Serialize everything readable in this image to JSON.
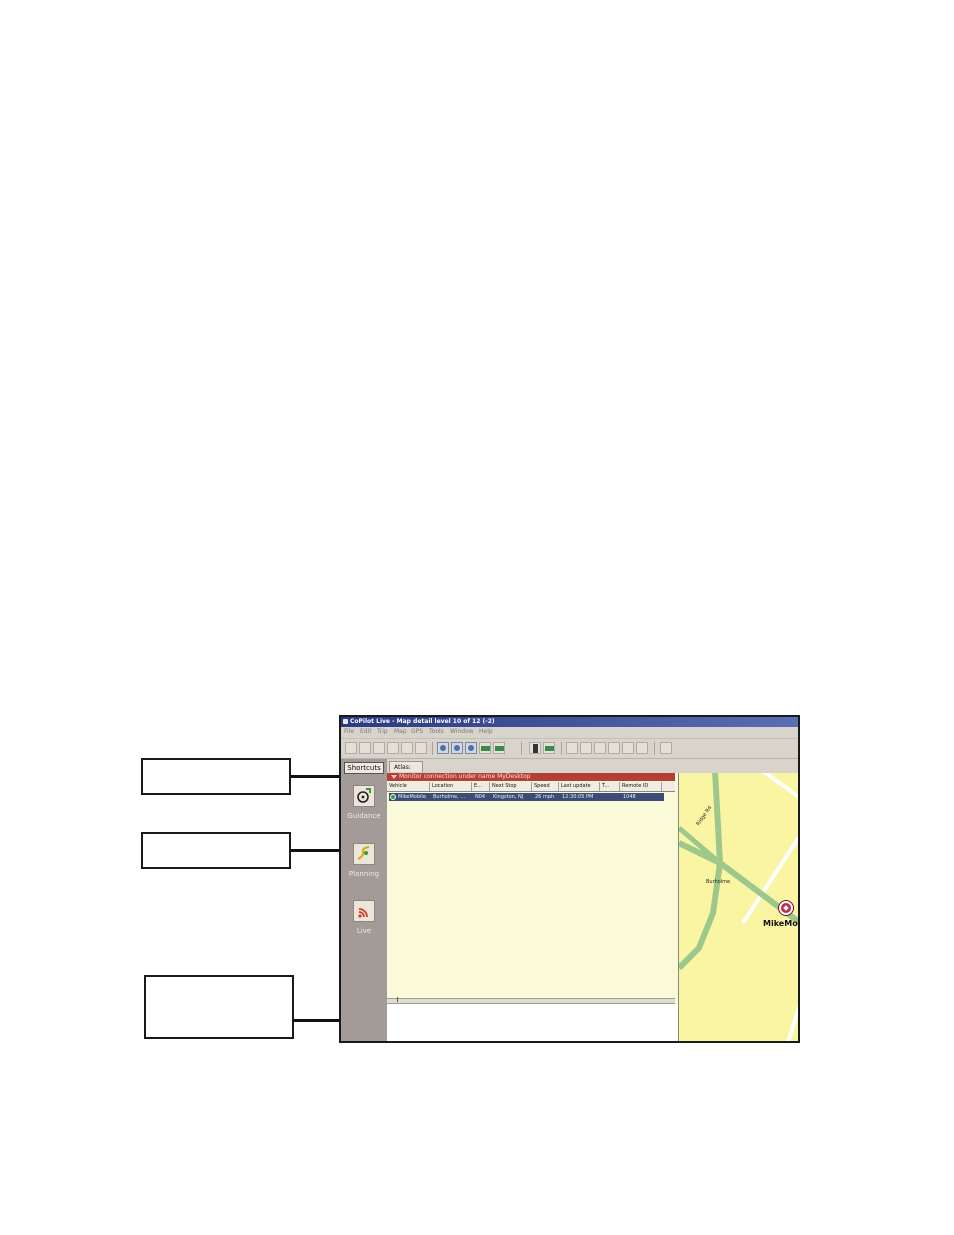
{
  "window": {
    "title": "CoPilot Live - Map detail level 10 of 12 (-2)"
  },
  "menu": [
    "File",
    "Edit",
    "Trip",
    "Map",
    "GPS",
    "Tools",
    "Window",
    "Help"
  ],
  "sidebar": {
    "shortcuts_label": "Shortcuts",
    "items": [
      {
        "label": "Guidance",
        "icon": "steering-wheel-icon"
      },
      {
        "label": "Planning",
        "icon": "route-planning-icon"
      },
      {
        "label": "Live",
        "icon": "live-signal-icon"
      }
    ]
  },
  "tabs": {
    "atlas": "Atlas:"
  },
  "monitor": {
    "connection_text": "Monitor connection under name MyDesktop",
    "columns": [
      "Vehicle",
      "Location",
      "E...",
      "Next Stop",
      "Speed",
      "Last update",
      "T...",
      "Remote ID"
    ],
    "rows": [
      {
        "vehicle": "MikeMobile",
        "location": "Burholme, ...",
        "e": "N04",
        "next_stop": "Kingston, NJ",
        "speed": "26 mph",
        "last_update": "12:30:05 PM",
        "t": "",
        "remote_id": "1048"
      }
    ]
  },
  "map": {
    "road_label": "Ridge Rd",
    "place_label": "Burholme",
    "vehicle_label": "MikeMobi"
  },
  "colors": {
    "monitor_bar": "#b43f36",
    "panel_bg": "#fbfad8",
    "map_bg": "#faf5a2",
    "sidebar_bg": "#a39b98",
    "vehicle_marker": "#c2274a"
  }
}
